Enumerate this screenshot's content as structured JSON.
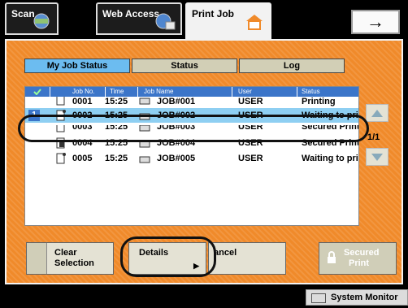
{
  "top_tabs": {
    "scan": "Scan",
    "web_access": "Web Access",
    "print_job": "Print Job",
    "arrow_icon": "right-arrow-icon"
  },
  "sub_tabs": {
    "my_job_status": "My Job Status",
    "status": "Status",
    "log": "Log"
  },
  "table": {
    "headers": [
      "Job No.",
      "Time",
      "Job Name",
      "User",
      "Status"
    ],
    "rows": [
      {
        "no": "0001",
        "time": "15:25",
        "name": "JOB#001",
        "user": "USER",
        "status": "Printing"
      },
      {
        "no": "0002",
        "time": "15:25",
        "name": "JOB#002",
        "user": "USER",
        "status": "Waiting to print",
        "index": "1",
        "selected": true
      },
      {
        "no": "0003",
        "time": "15:25",
        "name": "JOB#003",
        "user": "USER",
        "status": "Secured Print"
      },
      {
        "no": "0004",
        "time": "15:25",
        "name": "JOB#004",
        "user": "USER",
        "status": "Secured Print"
      },
      {
        "no": "0005",
        "time": "15:25",
        "name": "JOB#005",
        "user": "USER",
        "status": "Waiting to print"
      }
    ]
  },
  "page": "1/1",
  "buttons": {
    "clear_selection": [
      "Clear",
      "Selection"
    ],
    "details": "Details",
    "cancel": "ancel",
    "secured_print": [
      "Secured",
      "Print"
    ]
  },
  "status_bar": {
    "system_monitor": "System Monitor"
  },
  "colors": {
    "panel": "#f08a2a",
    "selected_row": "#8ecff2",
    "header": "#3b75c9",
    "active_subtab": "#6cbcf0"
  }
}
